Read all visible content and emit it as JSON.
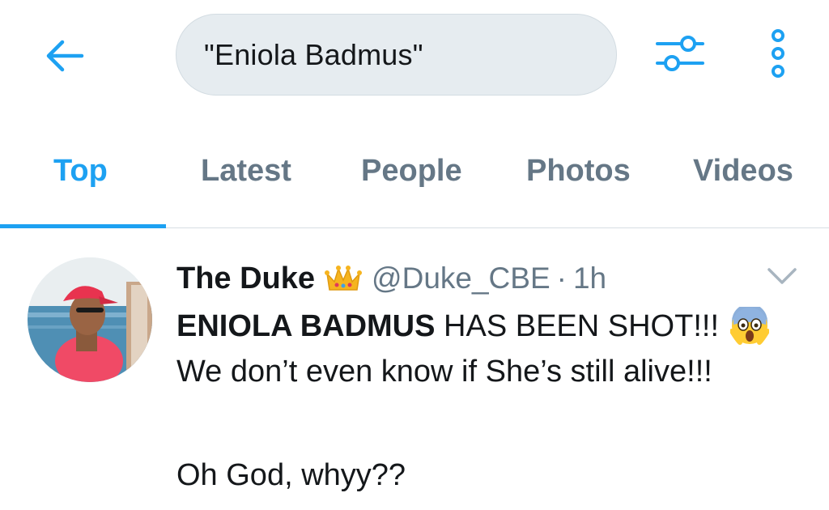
{
  "search": {
    "query": "\"Eniola Badmus\""
  },
  "tabs": [
    {
      "label": "Top",
      "active": true
    },
    {
      "label": "Latest",
      "active": false
    },
    {
      "label": "People",
      "active": false
    },
    {
      "label": "Photos",
      "active": false
    },
    {
      "label": "Videos",
      "active": false
    }
  ],
  "tweet": {
    "display_name": "The Duke",
    "handle": "@Duke_CBE",
    "separator": "·",
    "time": "1h",
    "lines": {
      "bold_part": "ENIOLA BADMUS",
      "rest_part": " HAS BEEN SHOT!!!",
      "line2": "We don’t even know if She’s still alive!!!",
      "line3": "Oh God, whyy??"
    }
  },
  "icons": {
    "back": "arrow-left-icon",
    "filter": "sliders-icon",
    "more": "more-vertical-icon",
    "caret": "chevron-down-icon",
    "crown": "crown-emoji-icon",
    "scream": "screaming-face-emoji-icon"
  },
  "colors": {
    "accent": "#1da1f2",
    "secondary_text": "#657786",
    "search_bg": "#e6ecf0"
  }
}
